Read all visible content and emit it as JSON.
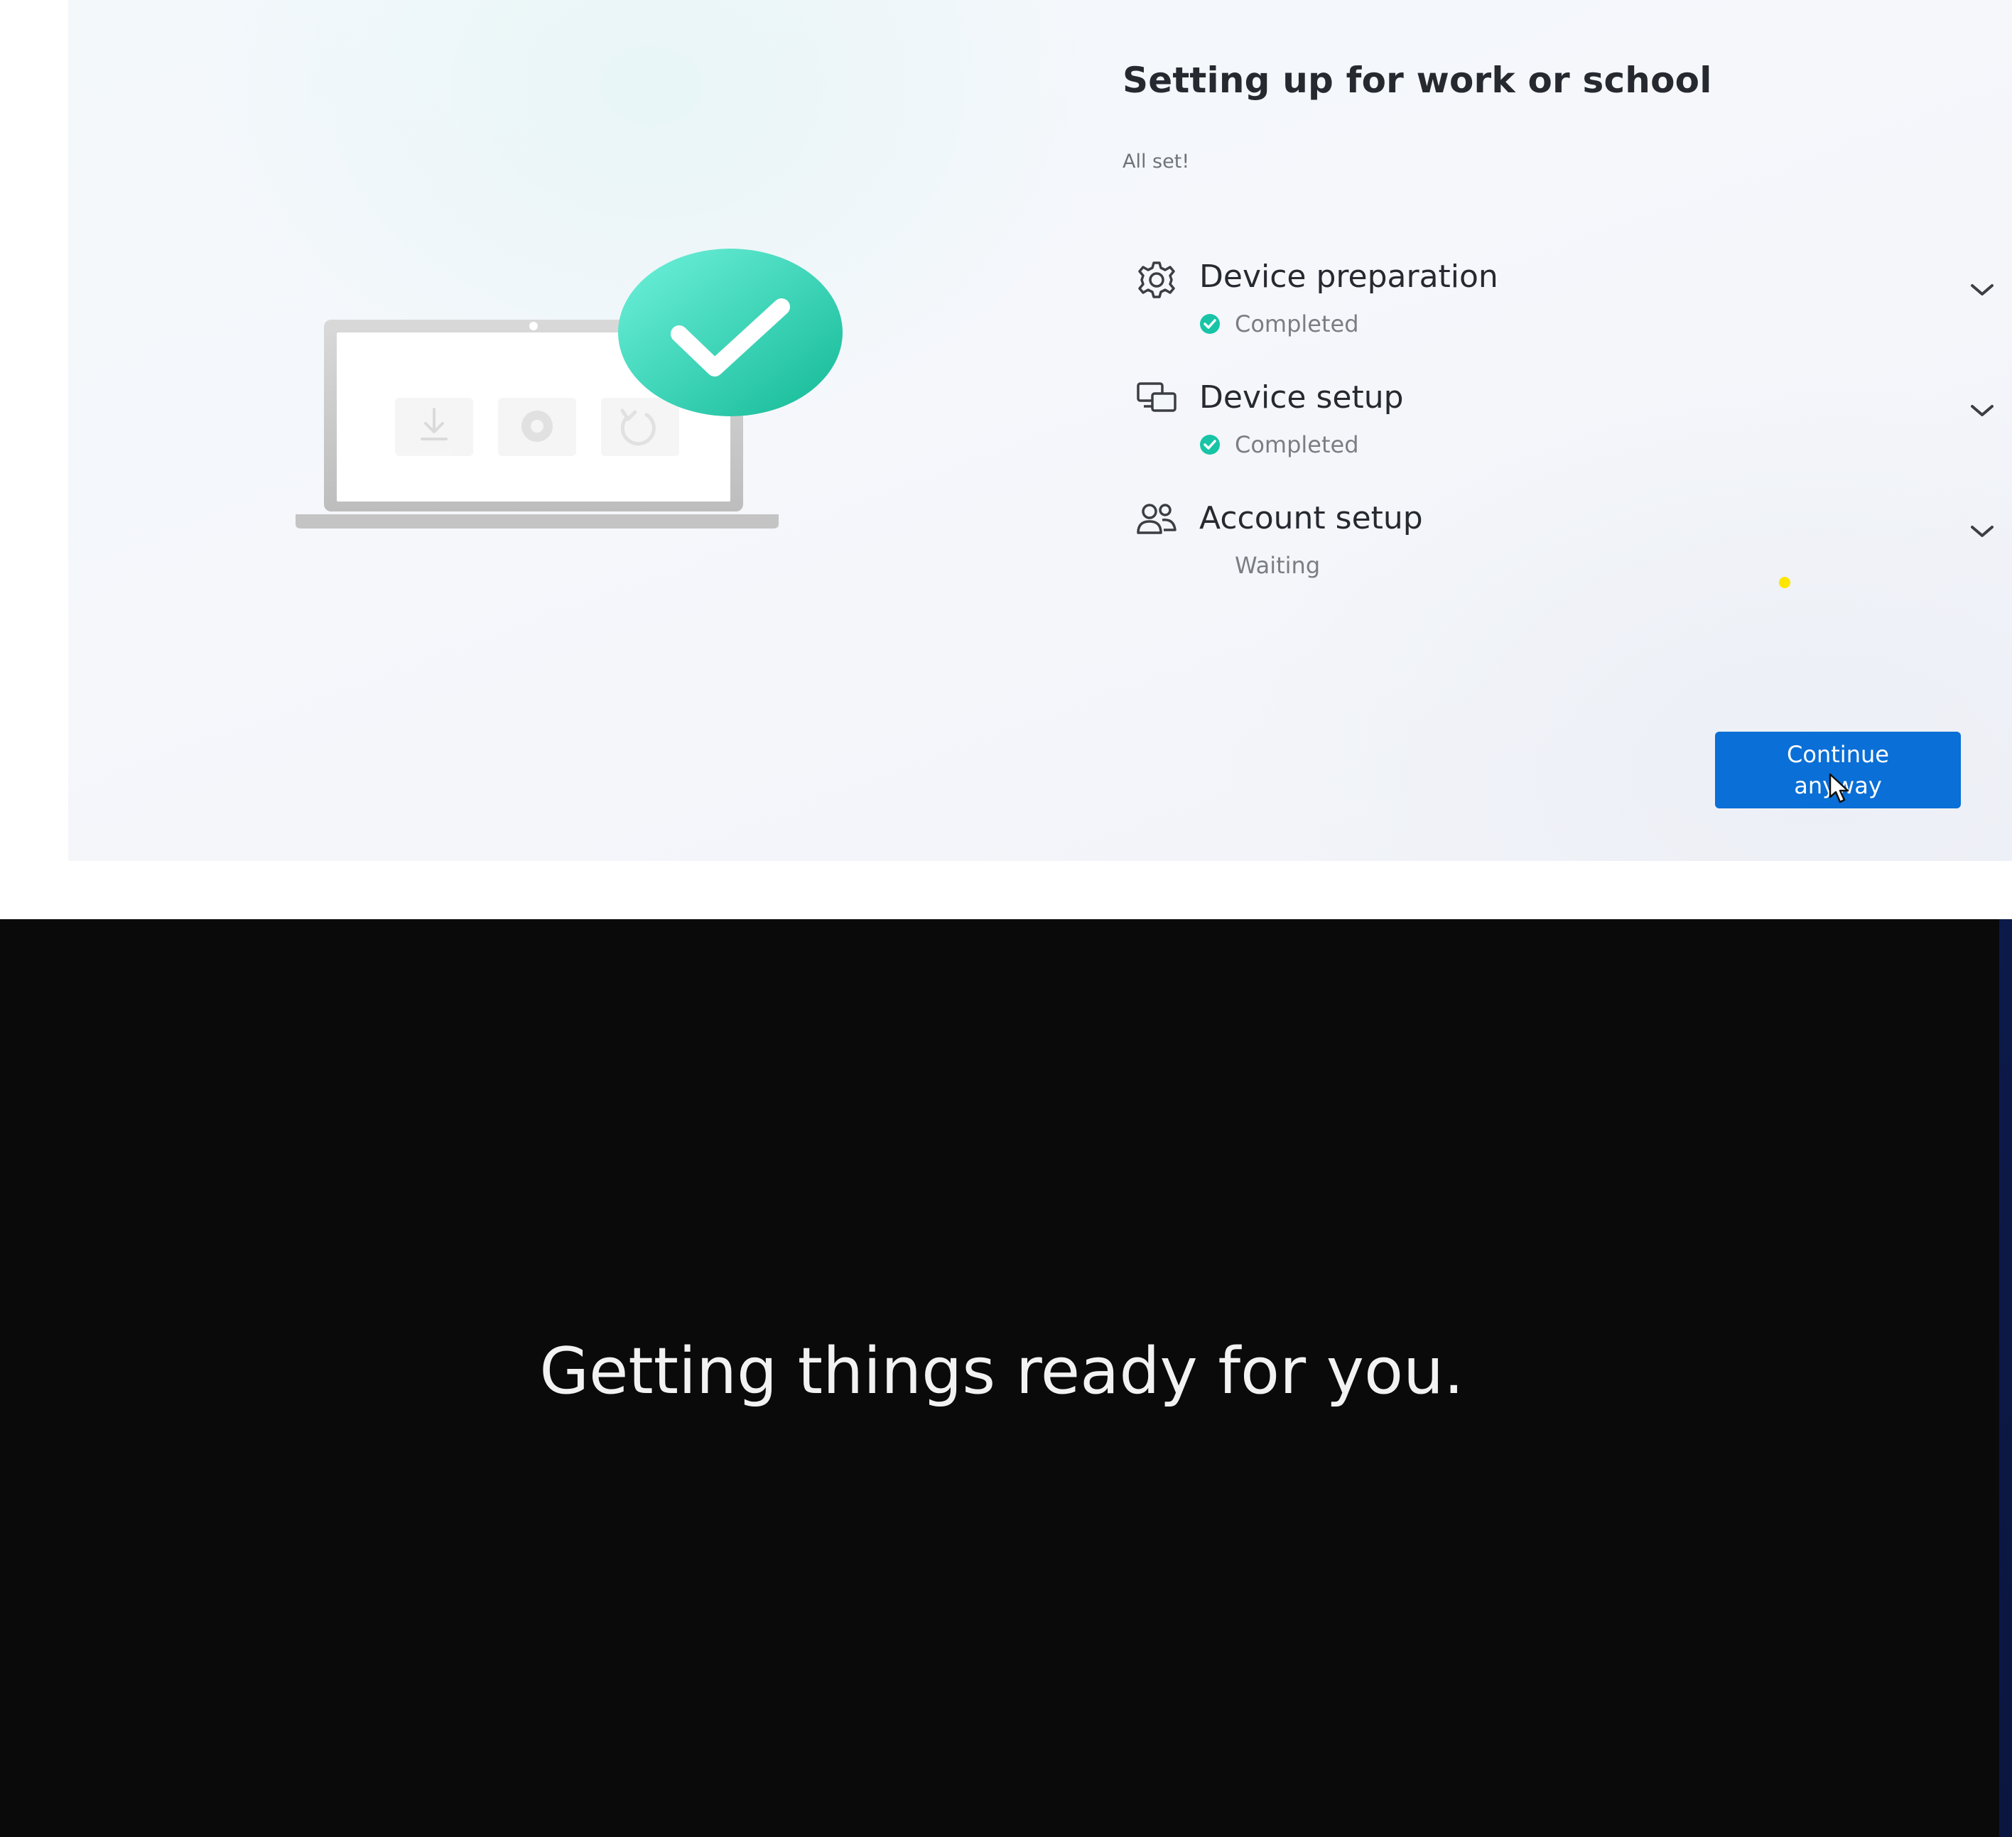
{
  "setup": {
    "title": "Setting up for work or school",
    "subtitle": "All set!",
    "steps": [
      {
        "label": "Device preparation",
        "status": "Completed",
        "icon": "gear-icon",
        "completed": true
      },
      {
        "label": "Device setup",
        "status": "Completed",
        "icon": "devices-icon",
        "completed": true
      },
      {
        "label": "Account setup",
        "status": "Waiting",
        "icon": "people-icon",
        "completed": false
      }
    ],
    "continue_label": "Continue anyway"
  },
  "colors": {
    "accent": "#0a6fd6",
    "success": "#18c4a6",
    "checkmark_badge": "#2fd8b8",
    "dark_background": "#0a0a0b"
  },
  "dark_screen": {
    "message": "Getting things ready for you."
  }
}
